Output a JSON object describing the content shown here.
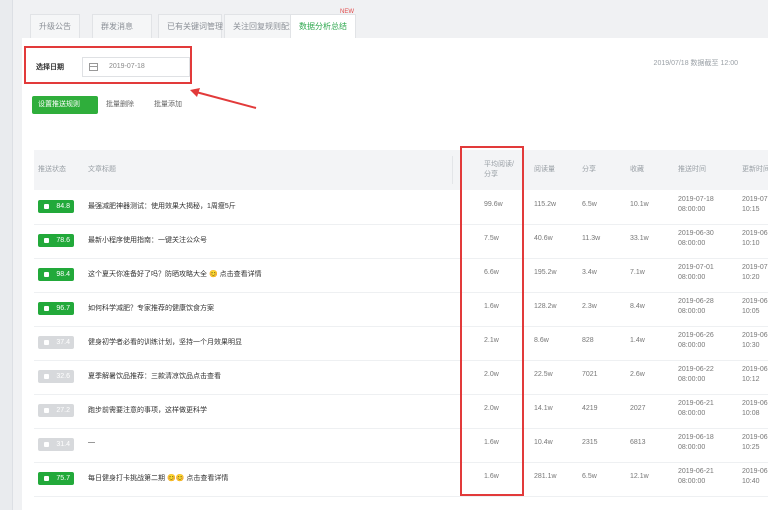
{
  "tabs": [
    {
      "label": "升级公告"
    },
    {
      "label": "群发消息"
    },
    {
      "label": "已有关键词管理"
    },
    {
      "label": "关注回复规则配置"
    },
    {
      "label": "数据分析总结"
    }
  ],
  "new_marker": "NEW",
  "date_filter": {
    "label": "选择日期",
    "value": "2019-07-18"
  },
  "right_info": "2019/07/18 数据截至   12:00",
  "buttons": {
    "primary": "设置推送规则",
    "secondary1": "批量删除",
    "secondary2": "批量添加"
  },
  "table": {
    "headers": [
      "推送状态",
      "文章标题",
      "平均阅读/分享",
      "阅读量",
      "分享",
      "收藏",
      "推送时间",
      "更新时间"
    ],
    "rows": [
      {
        "status": "84.8",
        "on": true,
        "title": "最强减肥神器测试：使用效果大揭秘，1周瘦5斤",
        "hl": "99.6w",
        "c1": "115.2w",
        "c2": "6.5w",
        "c3": "10.1w",
        "t1a": "2019-07-18",
        "t1b": "08:00:00",
        "t2a": "2019-07-18",
        "t2b": "10:15"
      },
      {
        "status": "78.6",
        "on": true,
        "title": "最新小程序使用指南：一键关注公众号",
        "hl": "7.5w",
        "c1": "40.6w",
        "c2": "11.3w",
        "c3": "33.1w",
        "t1a": "2019-06-30",
        "t1b": "08:00:00",
        "t2a": "2019-06-30",
        "t2b": "10:10"
      },
      {
        "status": "98.4",
        "on": true,
        "title": "这个夏天你准备好了吗？防晒攻略大全 😊 点击查看详情",
        "hl": "6.6w",
        "c1": "195.2w",
        "c2": "3.4w",
        "c3": "7.1w",
        "t1a": "2019-07-01",
        "t1b": "08:00:00",
        "t2a": "2019-07-01",
        "t2b": "10:20"
      },
      {
        "status": "96.7",
        "on": true,
        "title": "如何科学减肥？专家推荐的健康饮食方案",
        "hl": "1.6w",
        "c1": "128.2w",
        "c2": "2.3w",
        "c3": "8.4w",
        "t1a": "2019-06-28",
        "t1b": "08:00:00",
        "t2a": "2019-06-28",
        "t2b": "10:05"
      },
      {
        "status": "37.4",
        "on": false,
        "title": "健身初学者必看的训练计划，坚持一个月效果明显",
        "hl": "2.1w",
        "c1": "8.6w",
        "c2": "828",
        "c3": "1.4w",
        "t1a": "2019-06-26",
        "t1b": "08:00:00",
        "t2a": "2019-06-26",
        "t2b": "10:30"
      },
      {
        "status": "32.6",
        "on": false,
        "title": "夏季解暑饮品推荐：三款清凉饮品点击查看",
        "hl": "2.0w",
        "c1": "22.5w",
        "c2": "7021",
        "c3": "2.6w",
        "t1a": "2019-06-22",
        "t1b": "08:00:00",
        "t2a": "2019-06-22",
        "t2b": "10:12"
      },
      {
        "status": "27.2",
        "on": false,
        "title": "跑步前需要注意的事项，这样做更科学",
        "hl": "2.0w",
        "c1": "14.1w",
        "c2": "4219",
        "c3": "2027",
        "t1a": "2019-06-21",
        "t1b": "08:00:00",
        "t2a": "2019-06-21",
        "t2b": "10:08"
      },
      {
        "status": "31.4",
        "on": false,
        "title": "—",
        "hl": "1.6w",
        "c1": "10.4w",
        "c2": "2315",
        "c3": "6813",
        "t1a": "2019-06-18",
        "t1b": "08:00:00",
        "t2a": "2019-06-18",
        "t2b": "10:25"
      },
      {
        "status": "75.7",
        "on": true,
        "title": "每日健身打卡挑战第二期 😊😊 点击查看详情",
        "hl": "1.6w",
        "c1": "281.1w",
        "c2": "6.5w",
        "c3": "12.1w",
        "t1a": "2019-06-21",
        "t1b": "08:00:00",
        "t2a": "2019-06-21",
        "t2b": "10:40"
      }
    ]
  },
  "colors": {
    "accent": "#2fae3b",
    "highlight": "#e23a3a"
  }
}
